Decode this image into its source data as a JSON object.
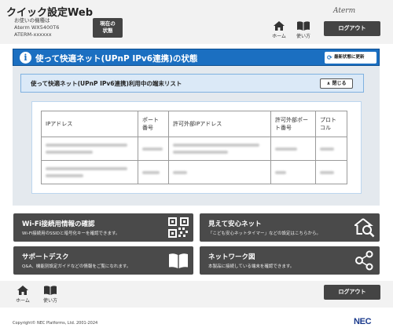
{
  "header": {
    "app_title": "クイック設定Web",
    "device_label": "お使いの機種は",
    "device_model": "Aterm WX5400T6",
    "device_id": "ATERM-xxxxxx",
    "status_button_line1": "現在の",
    "status_button_line2": "状態",
    "brand_logo": "Aterm",
    "nav_home": "ホーム",
    "nav_howto": "使い方",
    "logout": "ログアウト"
  },
  "main": {
    "title": "使って快適ネット(UPnP IPv6連携)の状態",
    "refresh_label": "最新状態に更新",
    "section_title": "使って快適ネット(UPnP IPv6連携)利用中の端末リスト",
    "close_label": "閉じる",
    "table": {
      "columns": [
        "IPアドレス",
        "ポート番号",
        "許可外部IPアドレス",
        "許可外部ポート番号",
        "プロトコル"
      ],
      "column_headers_display": [
        [
          "IPアドレス"
        ],
        [
          "ポート",
          "番号"
        ],
        [
          "許可外部IPアドレス"
        ],
        [
          "許可外部ポー",
          "ト番号"
        ],
        [
          "プロト",
          "コル"
        ]
      ]
    }
  },
  "cards": [
    {
      "title": "Wi-Fi接続用情報の確認",
      "desc": "Wi-Fi接続用のSSIDと暗号化キーを確認できます。",
      "icon": "qr-code-icon"
    },
    {
      "title": "見えて安心ネット",
      "desc": "「こども安心ネットタイマー」などの設定はこちらから。",
      "icon": "home-search-icon"
    },
    {
      "title": "サポートデスク",
      "desc": "Q&A、機能別設定ガイドなどの情報をご覧になれます。",
      "icon": "book-icon"
    },
    {
      "title": "ネットワーク図",
      "desc": "本製品に接続している端末を確認できます。",
      "icon": "network-icon"
    }
  ],
  "footer": {
    "nav_home": "ホーム",
    "nav_howto": "使い方",
    "logout": "ログアウト",
    "copyright": "Copyright© NEC Platforms, Ltd. 2001-2024",
    "nec_logo": "NEC"
  },
  "colors": {
    "accent_blue": "#1b6fc1",
    "dark_button": "#444444",
    "card_bg": "#4a4a4a"
  }
}
